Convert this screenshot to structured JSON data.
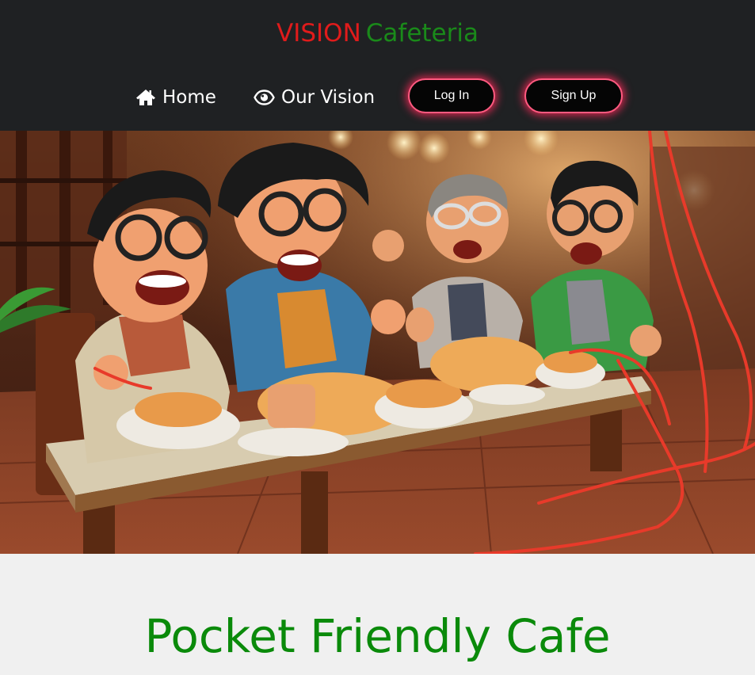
{
  "brand": {
    "word1": "VISION",
    "word2": "Cafeteria",
    "word1_color": "#e01b1b",
    "word2_color": "#1a8a1a"
  },
  "nav": {
    "home": {
      "label": "Home",
      "icon": "home-icon"
    },
    "vision": {
      "label": "Our Vision",
      "icon": "eye-icon"
    },
    "login_label": "Log In",
    "signup_label": "Sign Up"
  },
  "hero": {
    "image": "figurines-eating-noodles-photo"
  },
  "main": {
    "tagline": "Pocket Friendly Cafe",
    "tagline_color": "#0a8a0a"
  }
}
